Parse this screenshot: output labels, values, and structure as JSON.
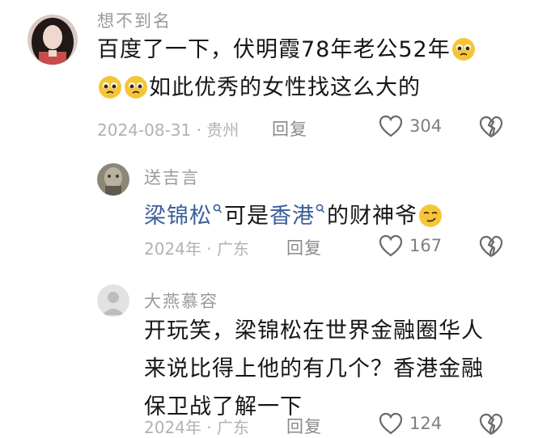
{
  "comments": [
    {
      "username": "想不到名",
      "line1": "百度了一下，伏明霞78年老公52年",
      "line2": "如此优秀的女性找这么大的",
      "meta": "2024-08-31 · 贵州",
      "reply_label": "回复",
      "likes": "304"
    },
    {
      "username": "送吉言",
      "link1": "梁锦松",
      "mid": "可是",
      "link2": "香港",
      "tail": "的财神爷",
      "meta": "2024年 · 广东",
      "reply_label": "回复",
      "likes": "167"
    },
    {
      "username": "大燕慕容",
      "line1": "开玩笑，梁锦松在世界金融圈华人",
      "line2": "来说比得上他的有几个？香港金融",
      "line3": "保卫战了解一下",
      "meta": "2024年 · 广东",
      "reply_label": "回复",
      "likes": "124"
    }
  ],
  "icons": {
    "like": "heart-outline-icon",
    "dislike": "broken-heart-icon",
    "search": "search-mini-icon",
    "emoji_pleading": "pleading-face-icon",
    "emoji_smirk": "smirking-face-icon"
  },
  "colors": {
    "link": "#3a5f9a",
    "muted": "#9a9a9a",
    "emoji_yellow": "#f6c536"
  }
}
